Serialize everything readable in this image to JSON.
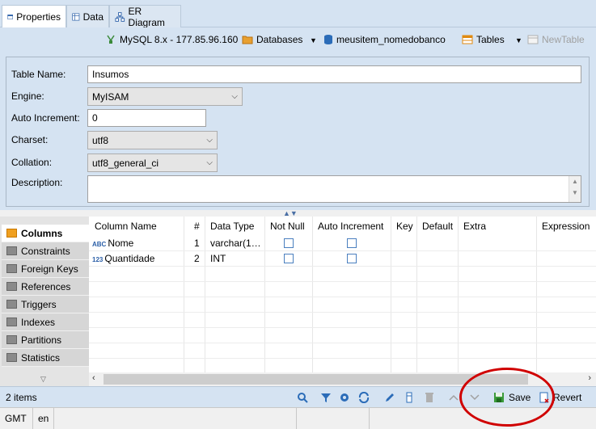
{
  "tabs": [
    {
      "label": "Properties",
      "active": true
    },
    {
      "label": "Data",
      "active": false
    },
    {
      "label": "ER Diagram",
      "active": false
    }
  ],
  "nav": {
    "connection": "MySQL 8.x - 177.85.96.160",
    "databases": "Databases",
    "schema": "meusitem_nomedobanco",
    "tables": "Tables",
    "new_table": "NewTable"
  },
  "props": {
    "table_name_label": "Table Name:",
    "table_name": "Insumos",
    "engine_label": "Engine:",
    "engine": "MyISAM",
    "auto_inc_label": "Auto Increment:",
    "auto_inc": "0",
    "charset_label": "Charset:",
    "charset": "utf8",
    "collation_label": "Collation:",
    "collation": "utf8_general_ci",
    "description_label": "Description:",
    "description": ""
  },
  "side": {
    "items": [
      "Columns",
      "Constraints",
      "Foreign Keys",
      "References",
      "Triggers",
      "Indexes",
      "Partitions",
      "Statistics"
    ]
  },
  "grid": {
    "headers": [
      "Column Name",
      "#",
      "Data Type",
      "Not Null",
      "Auto Increment",
      "Key",
      "Default",
      "Extra",
      "Expression"
    ],
    "rows": [
      {
        "icon": "ABC",
        "name": "Nome",
        "num": "1",
        "type": "varchar(1…",
        "not_null": false,
        "auto_inc": false
      },
      {
        "icon": "123",
        "name": "Quantidade",
        "num": "2",
        "type": "INT",
        "not_null": false,
        "auto_inc": false
      }
    ]
  },
  "status": {
    "items": "2 items",
    "save": "Save",
    "revert": "Revert"
  },
  "bottom": {
    "timezone": "GMT",
    "locale": "en"
  },
  "colors": {
    "panel": "#d5e3f2",
    "highlight_circle": "#d00000"
  }
}
